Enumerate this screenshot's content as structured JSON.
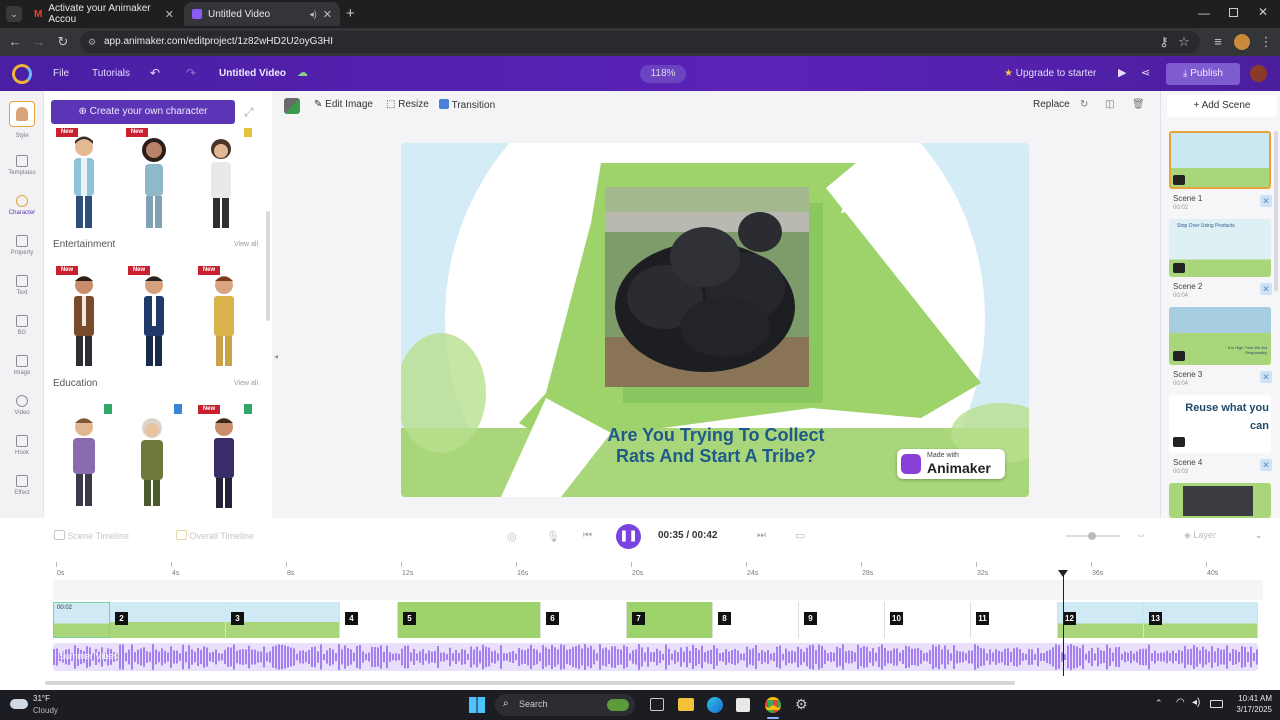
{
  "browser": {
    "tabs": [
      {
        "label": "Activate your Animaker Accou",
        "icon": "gmail-icon",
        "active": false
      },
      {
        "label": "Untitled Video",
        "icon": "animaker-icon",
        "active": true
      }
    ],
    "url": "app.animaker.com/editproject/1z82wHD2U2oyG3HI"
  },
  "app": {
    "menu": [
      "File",
      "Tutorials"
    ],
    "project_title": "Untitled Video",
    "zoom": "118%",
    "upgrade_label": "Upgrade to starter",
    "publish_label": "Publish"
  },
  "rail": {
    "items": [
      "Style",
      "Templates",
      "Character",
      "Property",
      "Text",
      "BG",
      "Image",
      "Video",
      "Hook",
      "Effect"
    ],
    "active": "Character"
  },
  "character_panel": {
    "create_label": "Create your own character",
    "new_badge": "New",
    "sections": [
      {
        "title": "Entertainment",
        "view_all": "View all"
      },
      {
        "title": "Education",
        "view_all": "View all"
      }
    ]
  },
  "canvas_toolbar": {
    "edit_image": "Edit Image",
    "resize": "Resize",
    "transition": "Transition",
    "replace": "Replace"
  },
  "stage": {
    "headline_line1": "Are You Trying To Collect",
    "headline_line2": "Rats And Start A Tribe?",
    "watermark_small": "Made with",
    "watermark_brand": "Animaker"
  },
  "scenes": {
    "add_label": "+ Add Scene",
    "list": [
      {
        "label": "Scene 1",
        "duration": "00:02"
      },
      {
        "label": "Scene 2",
        "duration": "00:04",
        "thumb_text": "Stop Over Using Products"
      },
      {
        "label": "Scene 3",
        "duration": "00:04",
        "thumb_text": "It is High Time We Act Responsibly"
      },
      {
        "label": "Scene 4",
        "duration": "00:03",
        "thumb_text": "Reuse what you can"
      }
    ]
  },
  "timeline": {
    "scene_timeline": "Scene Timeline",
    "overall_timeline": "Overall Timeline",
    "current_time": "00:35",
    "total_time": "00:42",
    "separator": "/",
    "layer_label": "Layer",
    "first_segment_time": "00:02",
    "ticks": [
      "0s",
      "4s",
      "8s",
      "12s",
      "16s",
      "20s",
      "24s",
      "28s",
      "32s",
      "36s",
      "40s"
    ],
    "segments": [
      "2",
      "3",
      "4",
      "5",
      "6",
      "7",
      "8",
      "9",
      "10",
      "11",
      "12",
      "13"
    ],
    "audio_label": "Summer Vibes",
    "playhead_seconds": 35
  },
  "taskbar": {
    "weather_temp": "31°F",
    "weather_desc": "Cloudy",
    "search_placeholder": "Search",
    "time": "10:41 AM",
    "date": "3/17/2025"
  },
  "colors": {
    "app_header": "#5a23b9",
    "accent": "#6b3fd4",
    "stage_green": "#9bd16b",
    "badge_red": "#c8202e"
  }
}
